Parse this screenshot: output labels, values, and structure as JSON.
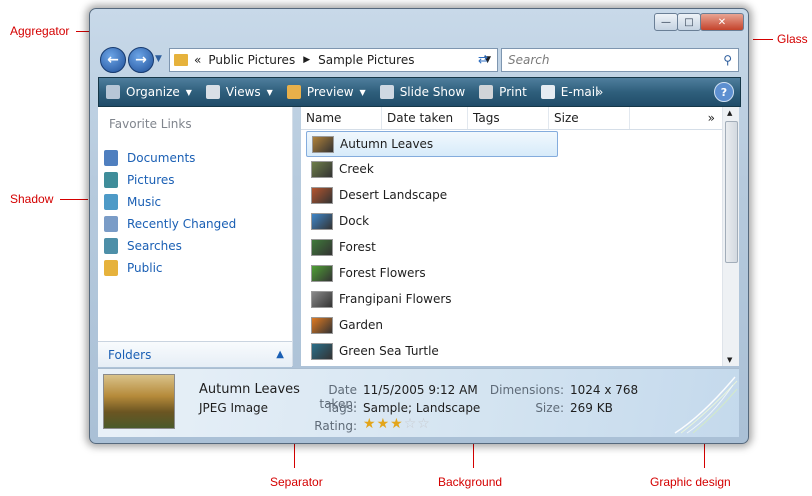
{
  "annotations": {
    "aggregator": "Aggregator",
    "glass": "Glass",
    "shadow": "Shadow",
    "separator": "Separator",
    "background": "Background",
    "graphic_design": "Graphic design"
  },
  "window": {
    "breadcrumb": [
      "«",
      "Public Pictures",
      "Sample Pictures"
    ],
    "search_placeholder": "Search",
    "toolbar": [
      {
        "label": "Organize",
        "icon": "organize-icon",
        "dropdown": true
      },
      {
        "label": "Views",
        "icon": "views-icon",
        "dropdown": true
      },
      {
        "label": "Preview",
        "icon": "preview-icon",
        "dropdown": true
      },
      {
        "label": "Slide Show",
        "icon": "slideshow-icon",
        "dropdown": false
      },
      {
        "label": "Print",
        "icon": "print-icon",
        "dropdown": false
      },
      {
        "label": "E-mail",
        "icon": "email-icon",
        "dropdown": false
      }
    ],
    "toolbar_more": "»",
    "help": "?"
  },
  "nav": {
    "header": "Favorite Links",
    "items": [
      {
        "label": "Documents",
        "color": "#4f7fbf"
      },
      {
        "label": "Pictures",
        "color": "#3f8d9a"
      },
      {
        "label": "Music",
        "color": "#4d9ac7"
      },
      {
        "label": "Recently Changed",
        "color": "#7a9cc7"
      },
      {
        "label": "Searches",
        "color": "#4d8fa8"
      },
      {
        "label": "Public",
        "color": "#e6b23c"
      }
    ],
    "folders_label": "Folders"
  },
  "list": {
    "columns": [
      "Name",
      "Date taken",
      "Tags",
      "Size"
    ],
    "more": "»",
    "items": [
      {
        "name": "Autumn Leaves",
        "color": "#b0823a",
        "selected": true
      },
      {
        "name": "Creek",
        "color": "#6f7f4a",
        "selected": false
      },
      {
        "name": "Desert Landscape",
        "color": "#b5552e",
        "selected": false
      },
      {
        "name": "Dock",
        "color": "#3e86c9",
        "selected": false
      },
      {
        "name": "Forest",
        "color": "#3f7a3a",
        "selected": false
      },
      {
        "name": "Forest Flowers",
        "color": "#4fa035",
        "selected": false
      },
      {
        "name": "Frangipani Flowers",
        "color": "#8a8a8a",
        "selected": false
      },
      {
        "name": "Garden",
        "color": "#e07a22",
        "selected": false
      },
      {
        "name": "Green Sea Turtle",
        "color": "#2a6f8a",
        "selected": false
      }
    ]
  },
  "details": {
    "title": "Autumn Leaves",
    "type": "JPEG Image",
    "date_label": "Date taken:",
    "date_value": "11/5/2005 9:12 AM",
    "tags_label": "Tags:",
    "tags_value": "Sample; Landscape",
    "rating_label": "Rating:",
    "rating": 3,
    "rating_max": 5,
    "dimensions_label": "Dimensions:",
    "dimensions_value": "1024 x 768",
    "size_label": "Size:",
    "size_value": "269 KB"
  }
}
